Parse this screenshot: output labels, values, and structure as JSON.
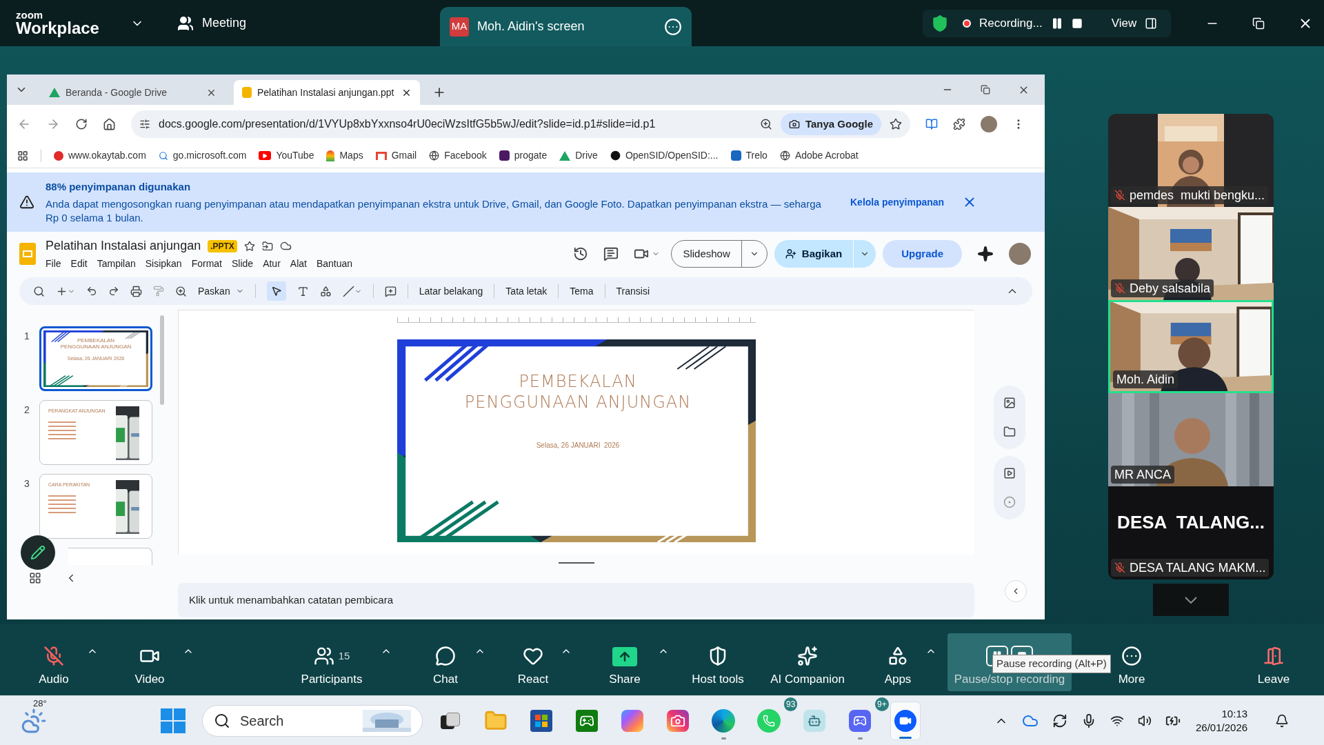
{
  "zoom_header": {
    "brand_small": "zoom",
    "brand": "Workplace",
    "meeting": "Meeting",
    "share_tab": {
      "initials": "MA",
      "title": "Moh. Aidin's screen"
    },
    "recording": {
      "label": "Recording..."
    },
    "view": "View"
  },
  "browser": {
    "tabs": [
      {
        "title": "Beranda - Google Drive",
        "selected": false
      },
      {
        "title": "Pelatihan Instalasi anjungan.ppt",
        "selected": true
      }
    ],
    "address": {
      "url": "docs.google.com/presentation/d/1VYUp8xbYxxnso4rU0eciWzsItfG5b5wJ/edit?slide=id.p1#slide=id.p1",
      "ask_chip": "Tanya Google"
    },
    "bookmarks": [
      "www.okaytab.com",
      "go.microsoft.com",
      "YouTube",
      "Maps",
      "Gmail",
      "Facebook",
      "progate",
      "Drive",
      "OpenSID/OpenSID:...",
      "Trelo",
      "Adobe Acrobat"
    ],
    "storage_banner": {
      "title": "88% penyimpanan digunakan",
      "message": "Anda dapat mengosongkan ruang penyimpanan atau mendapatkan penyimpanan ekstra untuk Drive, Gmail, dan Google Foto. Dapatkan penyimpanan ekstra — seharga Rp 0 selama 1 bulan.",
      "action": "Kelola penyimpanan"
    }
  },
  "slides": {
    "doc_title": "Pelatihan Instalasi anjungan",
    "file_badge": ".PPTX",
    "menus": [
      "File",
      "Edit",
      "Tampilan",
      "Sisipkan",
      "Format",
      "Slide",
      "Atur",
      "Alat",
      "Bantuan"
    ],
    "slideshow": "Slideshow",
    "share": "Bagikan",
    "upgrade": "Upgrade",
    "toolbar": {
      "zoom": "Paskan",
      "actions": [
        "Latar belakang",
        "Tata letak",
        "Tema",
        "Transisi"
      ]
    },
    "thumbnails": [
      {
        "number": "1",
        "selected": true,
        "kind": "title",
        "title": "PEMBEKALAN PENGGUNAAN ANJUNGAN",
        "subtitle": "Selasa, 26 JANUARI 2026"
      },
      {
        "number": "2",
        "selected": false,
        "kind": "bullets",
        "title": "PERANGKAT ANJUNGAN"
      },
      {
        "number": "3",
        "selected": false,
        "kind": "bullets",
        "title": "CARA PERAKITAN"
      }
    ],
    "current_slide": {
      "title_lines": [
        "PEMBEKALAN",
        "PENGGUNAAN ANJUNGAN"
      ],
      "date": "Selasa, 26 JANUARI  2026"
    },
    "notes_placeholder": "Klik untuk menambahkan catatan pembicara"
  },
  "participants": [
    {
      "name": "pemdes  mukti bengku...",
      "muted": true,
      "speaking": false,
      "kind": "video"
    },
    {
      "name": "Deby salsabila",
      "muted": true,
      "speaking": false,
      "kind": "video"
    },
    {
      "name": "Moh. Aidin",
      "muted": false,
      "speaking": true,
      "kind": "video"
    },
    {
      "name": "MR ANCA",
      "muted": false,
      "speaking": false,
      "kind": "video"
    },
    {
      "name": "DESA TALANG MAKM...",
      "muted": true,
      "speaking": false,
      "kind": "name_card",
      "card_text": "DESA  TALANG..."
    }
  ],
  "controls": [
    {
      "kind": "audio",
      "label": "Audio",
      "muted": true,
      "menu": true,
      "hovered": false
    },
    {
      "kind": "video",
      "label": "Video",
      "muted": false,
      "menu": true,
      "hovered": false
    },
    {
      "kind": "participants",
      "label": "Participants",
      "count": "15",
      "muted": false,
      "menu": true,
      "hovered": false
    },
    {
      "kind": "chat",
      "label": "Chat",
      "muted": false,
      "menu": true,
      "hovered": false
    },
    {
      "kind": "react",
      "label": "React",
      "muted": false,
      "menu": true,
      "hovered": false
    },
    {
      "kind": "share",
      "label": "Share",
      "muted": false,
      "menu": true,
      "hovered": false
    },
    {
      "kind": "host",
      "label": "Host tools",
      "muted": false,
      "menu": false,
      "hovered": false
    },
    {
      "kind": "ai",
      "label": "AI Companion",
      "muted": false,
      "menu": false,
      "hovered": false
    },
    {
      "kind": "apps",
      "label": "Apps",
      "muted": false,
      "menu": true,
      "hovered": false
    },
    {
      "kind": "record",
      "label": "Pause/stop recording",
      "muted": false,
      "menu": false,
      "hovered": true
    },
    {
      "kind": "more",
      "label": "More",
      "muted": false,
      "menu": false,
      "hovered": false
    },
    {
      "kind": "leave",
      "label": "Leave",
      "muted": false,
      "menu": false,
      "hovered": false
    }
  ],
  "tooltip": "Pause recording (Alt+P)",
  "taskbar": {
    "weather": "28°",
    "search": {
      "placeholder": "Search"
    },
    "apps": [
      {
        "kind": "taskview",
        "running": false,
        "selected": false
      },
      {
        "kind": "explorer",
        "running": false,
        "selected": false
      },
      {
        "kind": "store",
        "running": false,
        "selected": false
      },
      {
        "kind": "xbox",
        "running": false,
        "selected": false
      },
      {
        "kind": "copilot",
        "running": false,
        "selected": false
      },
      {
        "kind": "instagram",
        "running": false,
        "selected": false
      },
      {
        "kind": "edge",
        "running": true,
        "selected": false
      },
      {
        "kind": "whatsapp",
        "running": false,
        "selected": false,
        "badge": "93"
      },
      {
        "kind": "assistant",
        "running": false,
        "selected": false
      },
      {
        "kind": "discord",
        "running": true,
        "selected": false,
        "badge": "9+"
      },
      {
        "kind": "zoom",
        "running": true,
        "selected": true
      }
    ],
    "time": "10:13",
    "date": "26/01/2026"
  }
}
